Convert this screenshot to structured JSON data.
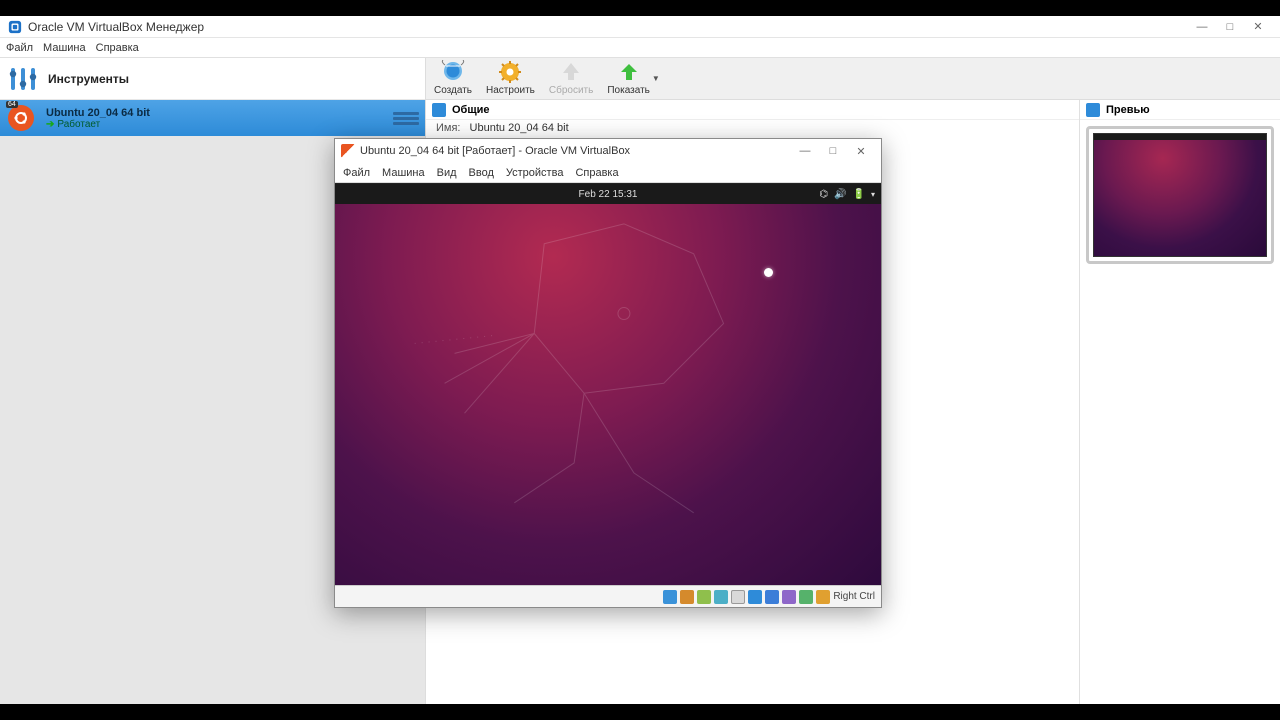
{
  "manager": {
    "title": "Oracle VM VirtualBox Менеджер",
    "menu": {
      "file": "Файл",
      "machine": "Машина",
      "help": "Справка"
    },
    "tools_label": "Инструменты",
    "window_controls": {
      "min": "—",
      "max": "□",
      "close": "✕"
    }
  },
  "toolbar": {
    "create": "Создать",
    "configure": "Настроить",
    "reset": "Сбросить",
    "show": "Показать"
  },
  "vm_list": {
    "selected": {
      "name": "Ubuntu 20_04 64 bit",
      "status": "Работает",
      "os_badge": "64"
    }
  },
  "details": {
    "general_header": "Общие",
    "name_key": "Имя:",
    "name_val": "Ubuntu 20_04 64 bit",
    "preview_header": "Превью"
  },
  "vm_window": {
    "title": "Ubuntu 20_04 64 bit [Работает] - Oracle VM VirtualBox",
    "menu": {
      "file": "Файл",
      "machine": "Машина",
      "view": "Вид",
      "input": "Ввод",
      "devices": "Устройства",
      "help": "Справка"
    },
    "guest_clock": "Feb 22  15:31",
    "host_key": "Right Ctrl",
    "window_controls": {
      "min": "—",
      "max": "□",
      "close": "✕"
    }
  }
}
